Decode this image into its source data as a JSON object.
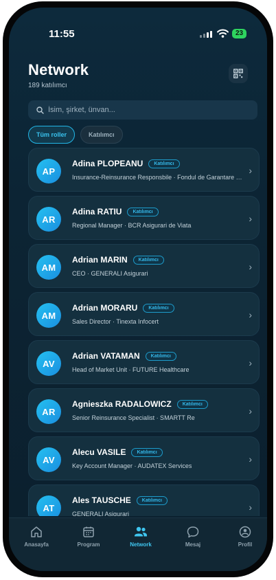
{
  "status_bar": {
    "time": "11:55",
    "battery": "23"
  },
  "header": {
    "title": "Network",
    "subtitle": "189 katılımcı"
  },
  "search": {
    "placeholder": "İsim, şirket, ünvan..."
  },
  "filters": [
    {
      "label": "Tüm roller",
      "active": true
    },
    {
      "label": "Katılımcı",
      "active": false
    }
  ],
  "badge_label": "Katılımcı",
  "people": [
    {
      "initials": "AP",
      "name": "Adina PLOPEANU",
      "role": "Insurance-Reinsurance Responsbile · Fondul de Garantare a Asiguratilor"
    },
    {
      "initials": "AR",
      "name": "Adina RATIU",
      "role": "Regional Manager · BCR Asigurari de Viata"
    },
    {
      "initials": "AM",
      "name": "Adrian MARIN",
      "role": "CEO · GENERALI Asigurari"
    },
    {
      "initials": "AM",
      "name": "Adrian MORARU",
      "role": "Sales Director · Tinexta Infocert"
    },
    {
      "initials": "AV",
      "name": "Adrian VATAMAN",
      "role": "Head of Market Unit · FUTURE Healthcare"
    },
    {
      "initials": "AR",
      "name": "Agnieszka RADALOWICZ",
      "role": "Senior Reinsurance Specialist · SMARTT Re"
    },
    {
      "initials": "AV",
      "name": "Alecu VASILE",
      "role": "Key Account Manager · AUDATEX Services"
    },
    {
      "initials": "AT",
      "name": "Ales TAUSCHE",
      "role": "GENERALI Asigurari"
    }
  ],
  "tabs": [
    {
      "label": "Anasayfa",
      "icon": "home-icon",
      "active": false
    },
    {
      "label": "Program",
      "icon": "calendar-icon",
      "active": false
    },
    {
      "label": "Network",
      "icon": "people-icon",
      "active": true
    },
    {
      "label": "Mesaj",
      "icon": "message-icon",
      "active": false
    },
    {
      "label": "Profil",
      "icon": "profile-icon",
      "active": false
    }
  ],
  "colors": {
    "accent": "#22b7e8",
    "background": "#0c2434",
    "card": "#14303f"
  }
}
